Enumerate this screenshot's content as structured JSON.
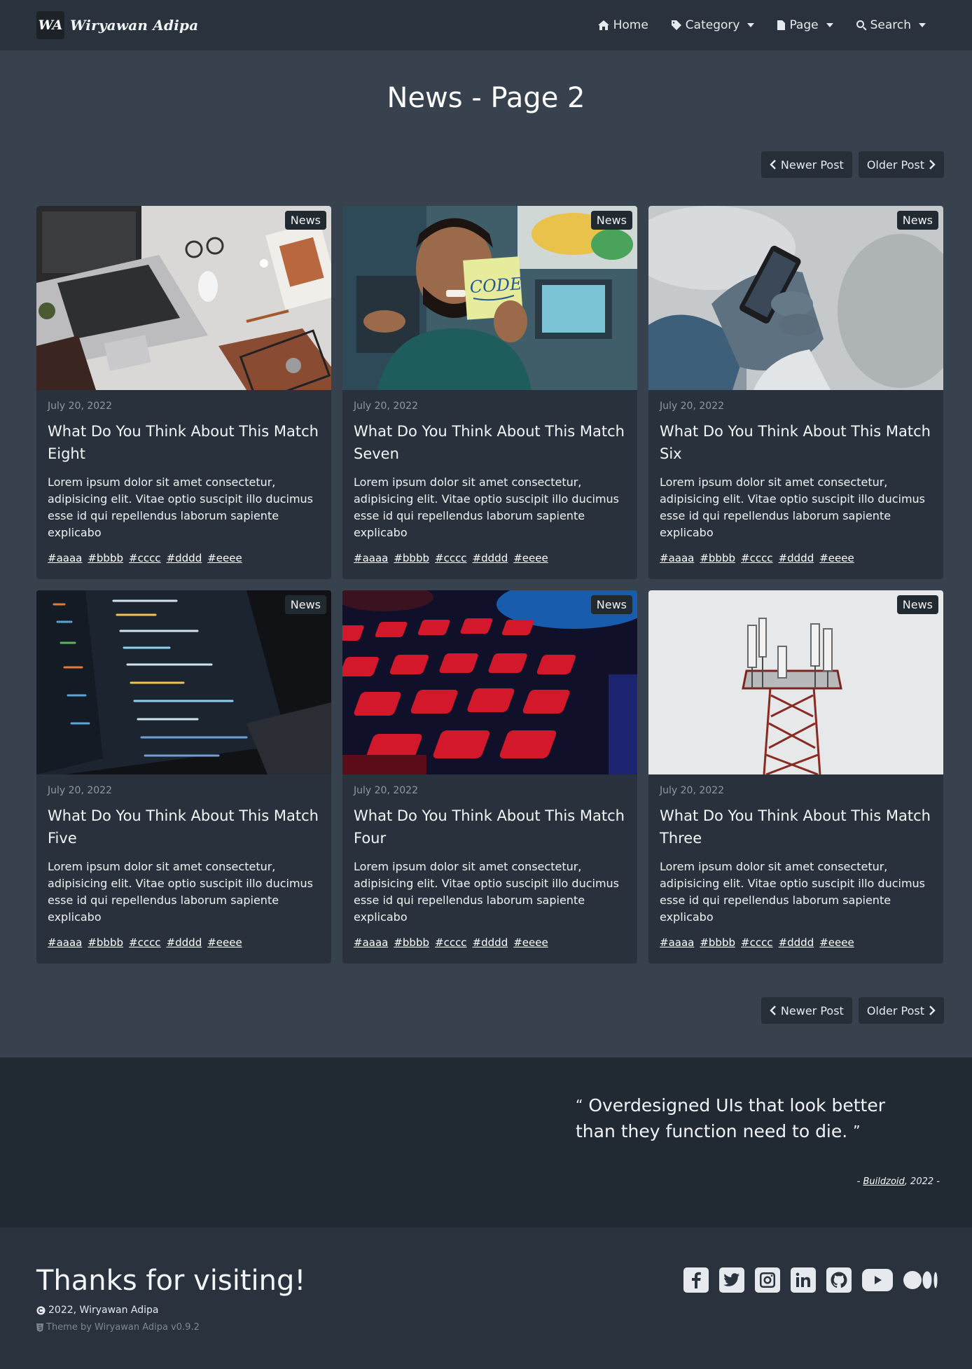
{
  "nav": {
    "logo_text": "WA",
    "brand": "Wiryawan Adipa",
    "items": [
      {
        "label": "Home",
        "icon": "home-icon",
        "dropdown": false
      },
      {
        "label": "Category",
        "icon": "tag-icon",
        "dropdown": true
      },
      {
        "label": "Page",
        "icon": "file-icon",
        "dropdown": true
      },
      {
        "label": "Search",
        "icon": "search-icon",
        "dropdown": true
      }
    ]
  },
  "page": {
    "title": "News - Page 2"
  },
  "pager": {
    "newer": "Newer Post",
    "older": "Older Post"
  },
  "posts": [
    {
      "badge": "News",
      "date": "July 20, 2022",
      "title": "What Do You Think About This Match Eight",
      "excerpt": "Lorem ipsum dolor sit amet consectetur, adipisicing elit. Vitae optio suscipit illo ducimus esse id qui repellendus laborum sapiente explicabo",
      "tags": [
        "#aaaa",
        "#bbbb",
        "#cccc",
        "#dddd",
        "#eeee"
      ]
    },
    {
      "badge": "News",
      "date": "July 20, 2022",
      "title": "What Do You Think About This Match Seven",
      "excerpt": "Lorem ipsum dolor sit amet consectetur, adipisicing elit. Vitae optio suscipit illo ducimus esse id qui repellendus laborum sapiente explicabo",
      "tags": [
        "#aaaa",
        "#bbbb",
        "#cccc",
        "#dddd",
        "#eeee"
      ]
    },
    {
      "badge": "News",
      "date": "July 20, 2022",
      "title": "What Do You Think About This Match Six",
      "excerpt": "Lorem ipsum dolor sit amet consectetur, adipisicing elit. Vitae optio suscipit illo ducimus esse id qui repellendus laborum sapiente explicabo",
      "tags": [
        "#aaaa",
        "#bbbb",
        "#cccc",
        "#dddd",
        "#eeee"
      ]
    },
    {
      "badge": "News",
      "date": "July 20, 2022",
      "title": "What Do You Think About This Match Five",
      "excerpt": "Lorem ipsum dolor sit amet consectetur, adipisicing elit. Vitae optio suscipit illo ducimus esse id qui repellendus laborum sapiente explicabo",
      "tags": [
        "#aaaa",
        "#bbbb",
        "#cccc",
        "#dddd",
        "#eeee"
      ]
    },
    {
      "badge": "News",
      "date": "July 20, 2022",
      "title": "What Do You Think About This Match Four",
      "excerpt": "Lorem ipsum dolor sit amet consectetur, adipisicing elit. Vitae optio suscipit illo ducimus esse id qui repellendus laborum sapiente explicabo",
      "tags": [
        "#aaaa",
        "#bbbb",
        "#cccc",
        "#dddd",
        "#eeee"
      ]
    },
    {
      "badge": "News",
      "date": "July 20, 2022",
      "title": "What Do You Think About This Match Three",
      "excerpt": "Lorem ipsum dolor sit amet consectetur, adipisicing elit. Vitae optio suscipit illo ducimus esse id qui repellendus laborum sapiente explicabo",
      "tags": [
        "#aaaa",
        "#bbbb",
        "#cccc",
        "#dddd",
        "#eeee"
      ]
    }
  ],
  "quote": {
    "text": "Overdesigned UIs that look better than they function need to die.",
    "author": "Buildzoid",
    "year": ", 2022",
    "dash": "-"
  },
  "footer": {
    "thanks": "Thanks for visiting!",
    "copyright": "2022, Wiryawan Adipa",
    "theme": "Theme by Wiryawan Adipa v0.9.2",
    "socials": [
      "facebook-icon",
      "twitter-icon",
      "instagram-icon",
      "linkedin-icon",
      "github-icon",
      "youtube-icon",
      "medium-icon"
    ]
  },
  "colors": {
    "background": "#37424e",
    "navbar": "#2a333d",
    "card": "#29323c",
    "quote_band": "#212a33"
  }
}
